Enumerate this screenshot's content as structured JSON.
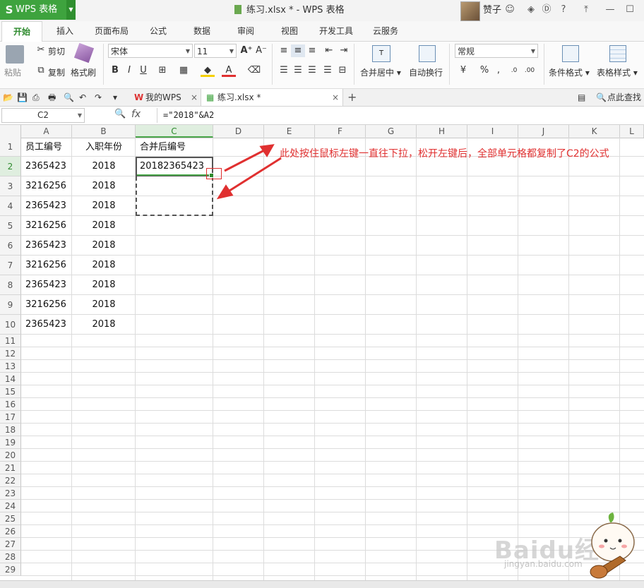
{
  "app": {
    "name": "WPS 表格",
    "logo": "S"
  },
  "window": {
    "title": "练习.xlsx * - WPS 表格",
    "user": "赞子"
  },
  "menu_tabs": [
    "开始",
    "插入",
    "页面布局",
    "公式",
    "数据",
    "审阅",
    "视图",
    "开发工具",
    "云服务"
  ],
  "ribbon": {
    "cut": "剪切",
    "copy": "复制",
    "paste": "粘贴",
    "format_painter": "格式刷",
    "font_name": "宋体",
    "font_size": "11",
    "merge_center": "合并居中",
    "wrap_text": "自动换行",
    "number_format": "常规",
    "conditional_format": "条件格式",
    "table_style": "表格样式"
  },
  "doc_tabs": {
    "wps_home": "我的WPS",
    "file": "练习.xlsx *"
  },
  "find_label": "点此查找命",
  "formula_bar": {
    "cell_ref": "C2",
    "fx": "fx",
    "formula": "=\"2018\"&A2"
  },
  "columns": [
    "A",
    "B",
    "C",
    "D",
    "E",
    "F",
    "G",
    "H",
    "I",
    "J",
    "K",
    "L"
  ],
  "rows": [
    "1",
    "2",
    "3",
    "4",
    "5",
    "6",
    "7",
    "8",
    "9",
    "10",
    "11",
    "12",
    "13",
    "14",
    "15",
    "16",
    "17",
    "18",
    "19",
    "20",
    "21",
    "22",
    "23",
    "24",
    "25",
    "26",
    "27",
    "28",
    "29"
  ],
  "table": {
    "headers": [
      "员工编号",
      "入职年份",
      "合并后编号"
    ],
    "data": [
      [
        "2365423",
        "2018",
        "20182365423"
      ],
      [
        "3216256",
        "2018",
        ""
      ],
      [
        "2365423",
        "2018",
        ""
      ],
      [
        "3216256",
        "2018",
        ""
      ],
      [
        "2365423",
        "2018",
        ""
      ],
      [
        "3216256",
        "2018",
        ""
      ],
      [
        "2365423",
        "2018",
        ""
      ],
      [
        "3216256",
        "2018",
        ""
      ],
      [
        "2365423",
        "2018",
        ""
      ]
    ]
  },
  "annotation": "此处按住鼠标左键一直往下拉，松开左键后，全部单元格都复制了C2的公式",
  "watermark": {
    "brand": "Baidu经验",
    "url": "jingyan.baidu.com"
  },
  "colors": {
    "accent": "#3ea33e",
    "annotation": "#e03030"
  }
}
